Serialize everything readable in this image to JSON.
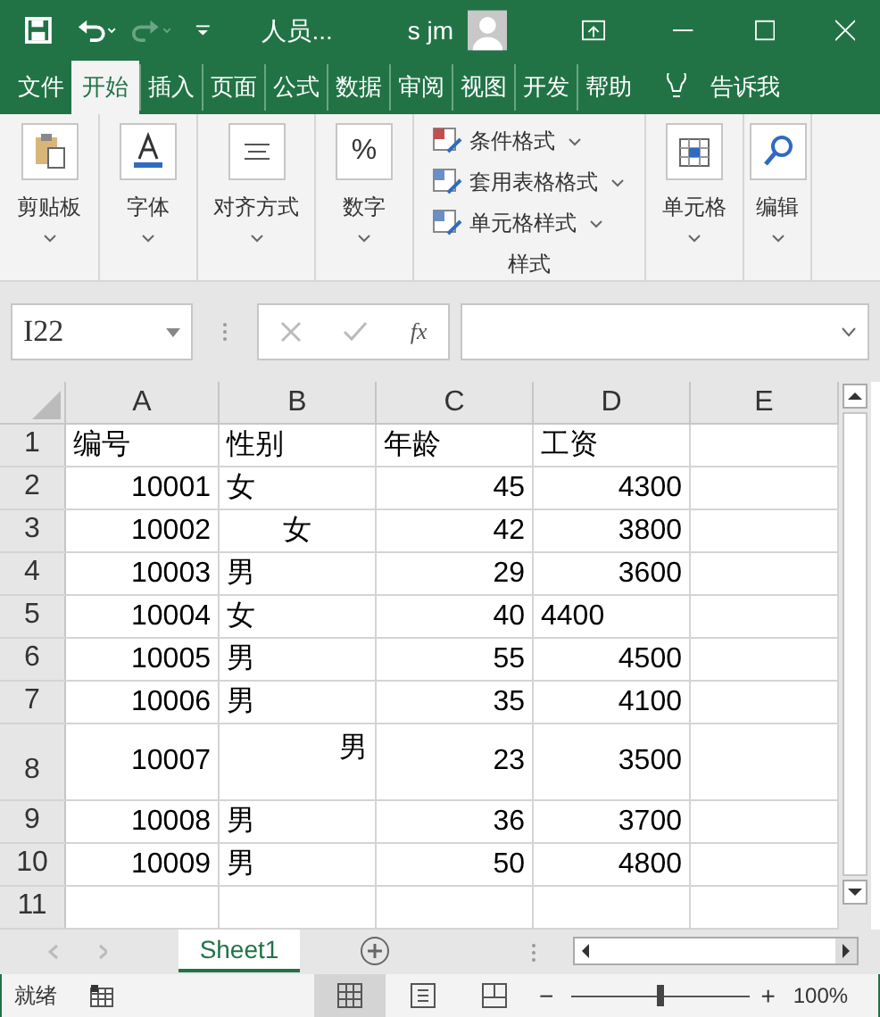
{
  "title_bar": {
    "title": "人员...",
    "user": "s jm"
  },
  "ribbon_tabs": [
    {
      "label": "文件",
      "selected": false
    },
    {
      "label": "开始",
      "selected": true
    },
    {
      "label": "插入",
      "selected": false
    },
    {
      "label": "页面",
      "selected": false
    },
    {
      "label": "公式",
      "selected": false
    },
    {
      "label": "数据",
      "selected": false
    },
    {
      "label": "审阅",
      "selected": false
    },
    {
      "label": "视图",
      "selected": false
    },
    {
      "label": "开发",
      "selected": false
    },
    {
      "label": "帮助",
      "selected": false
    }
  ],
  "tell_me": "告诉我",
  "ribbon_groups": [
    {
      "label": "剪贴板",
      "kind": "clipboard"
    },
    {
      "label": "字体",
      "kind": "font"
    },
    {
      "label": "对齐方式",
      "kind": "align"
    },
    {
      "label": "数字",
      "kind": "number",
      "icon_text": "%"
    },
    {
      "kind": "styles",
      "label": "样式",
      "items": [
        "条件格式",
        "套用表格格式",
        "单元格样式"
      ]
    },
    {
      "label": "单元格",
      "kind": "cells"
    },
    {
      "label": "编辑",
      "kind": "edit"
    }
  ],
  "name_box": "I22",
  "formula_icon": "fx",
  "columns": [
    "A",
    "B",
    "C",
    "D",
    "E"
  ],
  "rows": [
    {
      "number": "1",
      "kind": "normal",
      "cells": [
        {
          "text": "编号",
          "kind": "left"
        },
        {
          "text": "性别",
          "kind": "left"
        },
        {
          "text": "年龄",
          "kind": "left"
        },
        {
          "text": "工资",
          "kind": "left"
        },
        null
      ]
    },
    {
      "number": "2",
      "kind": "normal",
      "cells": [
        {
          "text": "10001",
          "kind": "right"
        },
        {
          "text": "女",
          "kind": "left"
        },
        {
          "text": "45",
          "kind": "right"
        },
        {
          "text": "4300",
          "kind": "right"
        },
        null
      ]
    },
    {
      "number": "3",
      "kind": "normal",
      "cells": [
        {
          "text": "10002",
          "kind": "right"
        },
        {
          "text": "女",
          "kind": "center"
        },
        {
          "text": "42",
          "kind": "right"
        },
        {
          "text": "3800",
          "kind": "right"
        },
        null
      ]
    },
    {
      "number": "4",
      "kind": "normal",
      "cells": [
        {
          "text": "10003",
          "kind": "right"
        },
        {
          "text": "男",
          "kind": "left"
        },
        {
          "text": "29",
          "kind": "right"
        },
        {
          "text": "3600",
          "kind": "right"
        },
        null
      ]
    },
    {
      "number": "5",
      "kind": "normal",
      "cells": [
        {
          "text": "10004",
          "kind": "right"
        },
        {
          "text": "女",
          "kind": "left"
        },
        {
          "text": "40",
          "kind": "right"
        },
        {
          "text": "4400",
          "kind": "left"
        },
        null
      ]
    },
    {
      "number": "6",
      "kind": "normal",
      "cells": [
        {
          "text": "10005",
          "kind": "right"
        },
        {
          "text": "男",
          "kind": "left"
        },
        {
          "text": "55",
          "kind": "right"
        },
        {
          "text": "4500",
          "kind": "right"
        },
        null
      ]
    },
    {
      "number": "7",
      "kind": "normal",
      "cells": [
        {
          "text": "10006",
          "kind": "right"
        },
        {
          "text": "男",
          "kind": "left"
        },
        {
          "text": "35",
          "kind": "right"
        },
        {
          "text": "4100",
          "kind": "right"
        },
        null
      ]
    },
    {
      "number": "8",
      "kind": "tall",
      "cells": [
        {
          "text": "10007",
          "kind": "right"
        },
        {
          "text": "男",
          "kind": "topright"
        },
        {
          "text": "23",
          "kind": "right"
        },
        {
          "text": "3500",
          "kind": "right"
        },
        null
      ]
    },
    {
      "number": "9",
      "kind": "normal",
      "cells": [
        {
          "text": "10008",
          "kind": "right"
        },
        {
          "text": "男",
          "kind": "left"
        },
        {
          "text": "36",
          "kind": "right"
        },
        {
          "text": "3700",
          "kind": "right"
        },
        null
      ]
    },
    {
      "number": "10",
      "kind": "normal",
      "cells": [
        {
          "text": "10009",
          "kind": "right"
        },
        {
          "text": "男",
          "kind": "left"
        },
        {
          "text": "50",
          "kind": "right"
        },
        {
          "text": "4800",
          "kind": "right"
        },
        null
      ]
    },
    {
      "number": "11",
      "kind": "normal",
      "cells": [
        null,
        null,
        null,
        null,
        null
      ]
    }
  ],
  "sheet_tabs": [
    {
      "label": "Sheet1",
      "selected": true
    }
  ],
  "status_bar": {
    "status": "就绪",
    "zoom_out": "−",
    "zoom_in": "+",
    "zoom": "100%",
    "zoom_level": {
      "level": 0.5
    }
  }
}
